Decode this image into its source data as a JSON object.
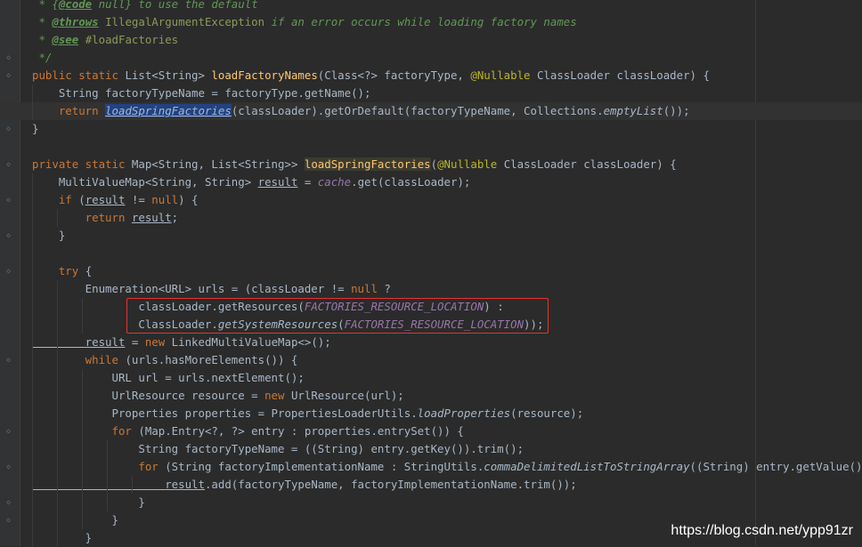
{
  "watermark": "https://blog.csdn.net/ypp91zr",
  "code": {
    "l1_c1": " * {",
    "l1_tag": "@code",
    "l1_c2": " null} to use the default",
    "l2_c1": " * ",
    "l2_tag": "@throws",
    "l2_type": " IllegalArgumentException",
    "l2_c2": " if an error occurs while loading factory names",
    "l3_c1": " * ",
    "l3_tag": "@see",
    "l3_ref": " #loadFactories",
    "l4": " */",
    "l5_kw": "public static ",
    "l5_a": "List<String> ",
    "l5_fn": "loadFactoryNames",
    "l5_b": "(Class<?> factoryType, ",
    "l5_ann": "@Nullable",
    "l5_c": " ClassLoader classLoader) {",
    "l6": "    String factoryTypeName = factoryType.getName();",
    "l7_kw": "    return ",
    "l7_sel": "loadSpringFactories",
    "l7_a": "(classLoader).getOrDefault(factoryTypeName, Collections.",
    "l7_st": "emptyList",
    "l7_b": "());",
    "l8": "}",
    "l9": "",
    "l10_kw": "private static ",
    "l10_a": "Map<String, List<String>> ",
    "l10_fn": "loadSpringFactories",
    "l10_b": "(",
    "l10_ann": "@Nullable",
    "l10_c": " ClassLoader classLoader) {",
    "l11_a": "    MultiValueMap<String, String> ",
    "l11_res": "result",
    "l11_b": " = ",
    "l11_fld": "cache",
    "l11_c": ".get(classLoader);",
    "l12_kw": "    if ",
    "l12_a": "(",
    "l12_res": "result",
    "l12_b": " != ",
    "l12_null": "null",
    "l12_c": ") {",
    "l13_kw": "        return ",
    "l13_res": "result",
    "l13_a": ";",
    "l14": "    }",
    "l15": "",
    "l16_kw": "    try ",
    "l16_a": "{",
    "l17_a": "        Enumeration<URL> urls = (classLoader != ",
    "l17_null": "null",
    "l17_b": " ?",
    "l18_a": "                classLoader.getResources(",
    "l18_fld": "FACTORIES_RESOURCE_LOCATION",
    "l18_b": ") :",
    "l19_a": "                ClassLoader.",
    "l19_st": "getSystemResources",
    "l19_b": "(",
    "l19_fld": "FACTORIES_RESOURCE_LOCATION",
    "l19_c": "));",
    "l20_res": "        result",
    "l20_a": " = ",
    "l20_kw": "new ",
    "l20_b": "LinkedMultiValueMap<>();",
    "l21_kw": "        while ",
    "l21_a": "(urls.hasMoreElements()) {",
    "l22": "            URL url = urls.nextElement();",
    "l23_a": "            UrlResource resource = ",
    "l23_kw": "new ",
    "l23_b": "UrlResource(url);",
    "l24_a": "            Properties properties = PropertiesLoaderUtils.",
    "l24_st": "loadProperties",
    "l24_b": "(resource);",
    "l25_kw": "            for ",
    "l25_a": "(Map.Entry<?, ?> entry : properties.entrySet()) {",
    "l26": "                String factoryTypeName = ((String) entry.getKey()).trim();",
    "l27_kw": "                for ",
    "l27_a": "(String factoryImplementationName : StringUtils.",
    "l27_st": "commaDelimitedListToStringArray",
    "l27_b": "((String) entry.getValue())) {",
    "l28_res": "                    result",
    "l28_a": ".add(factoryTypeName, factoryImplementationName.trim());",
    "l29": "                }",
    "l30": "            }",
    "l31": "        }"
  }
}
